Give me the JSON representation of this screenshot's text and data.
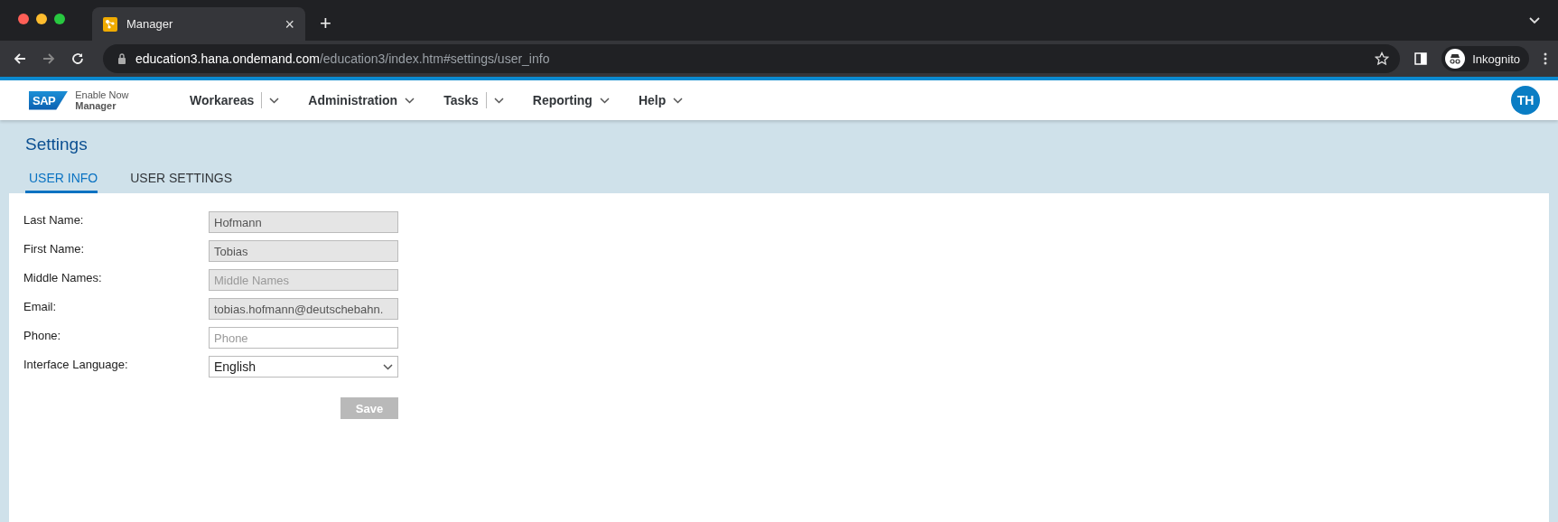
{
  "browser": {
    "tab": {
      "title": "Manager",
      "close": "×"
    },
    "new_tab": "+",
    "address": {
      "host": "education3.hana.ondemand.com",
      "path": "/education3/index.htm#settings/user_info"
    },
    "profile": "Inkognito"
  },
  "app": {
    "logo": "SAP",
    "product_line1": "Enable Now",
    "product_line2": "Manager",
    "nav": [
      {
        "label": "Workareas",
        "kind": "split"
      },
      {
        "label": "Administration",
        "kind": "menu"
      },
      {
        "label": "Tasks",
        "kind": "split"
      },
      {
        "label": "Reporting",
        "kind": "menu"
      },
      {
        "label": "Help",
        "kind": "menu"
      }
    ],
    "avatar": "TH"
  },
  "page": {
    "title": "Settings",
    "tabs": [
      {
        "label": "USER INFO",
        "selected": true
      },
      {
        "label": "USER SETTINGS",
        "selected": false
      }
    ]
  },
  "form": {
    "fields": [
      {
        "label": "Last Name:",
        "kind": "text",
        "value": "Hofmann",
        "disabled": true
      },
      {
        "label": "First Name:",
        "kind": "text",
        "value": "Tobias",
        "disabled": true
      },
      {
        "label": "Middle Names:",
        "kind": "text",
        "placeholder": "Middle Names",
        "disabled": true
      },
      {
        "label": "Email:",
        "kind": "text",
        "value": "tobias.hofmann@deutschebahn.",
        "disabled": true
      },
      {
        "label": "Phone:",
        "kind": "text",
        "placeholder": "Phone",
        "disabled": false
      },
      {
        "label": "Interface Language:",
        "kind": "select",
        "value": "English",
        "disabled": false
      }
    ],
    "save": {
      "label": "Save",
      "disabled": true
    }
  }
}
